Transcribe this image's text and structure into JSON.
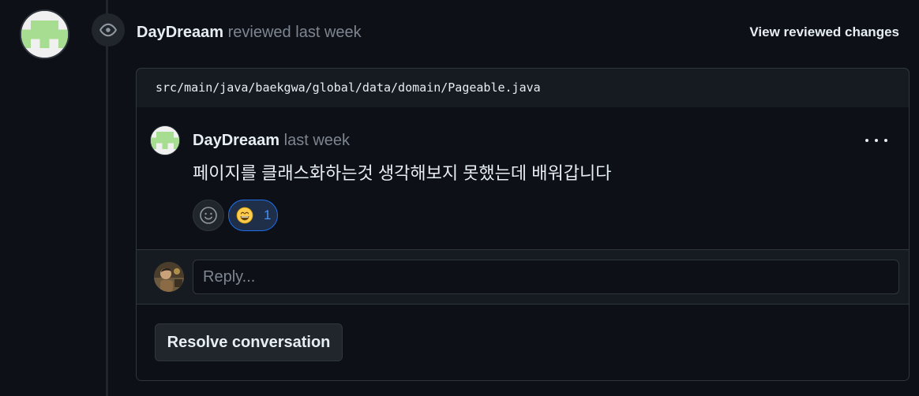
{
  "review": {
    "author": "DayDreaam",
    "action": "reviewed",
    "time": "last week",
    "view_changes_label": "View reviewed changes",
    "event_icon": "eye-icon"
  },
  "file": {
    "path": "src/main/java/baekgwa/global/data/domain/Pageable.java"
  },
  "comment": {
    "author": "DayDreaam",
    "time": "last week",
    "body": "페이지를 클래스화하는것 생각해보지 못했는데 배워갑니다",
    "menu_icon": "kebab-horizontal-icon",
    "add_reaction_icon": "smiley-icon",
    "reactions": [
      {
        "emoji": "😄",
        "icon": "grinning-face-icon",
        "count": "1"
      }
    ]
  },
  "reply": {
    "placeholder": "Reply..."
  },
  "resolve": {
    "label": "Resolve conversation"
  },
  "colors": {
    "background": "#0d1117",
    "border": "#30363d",
    "muted_text": "#7d8590",
    "accent_blue": "#4493f8",
    "avatar_green": "#a7dd91"
  }
}
